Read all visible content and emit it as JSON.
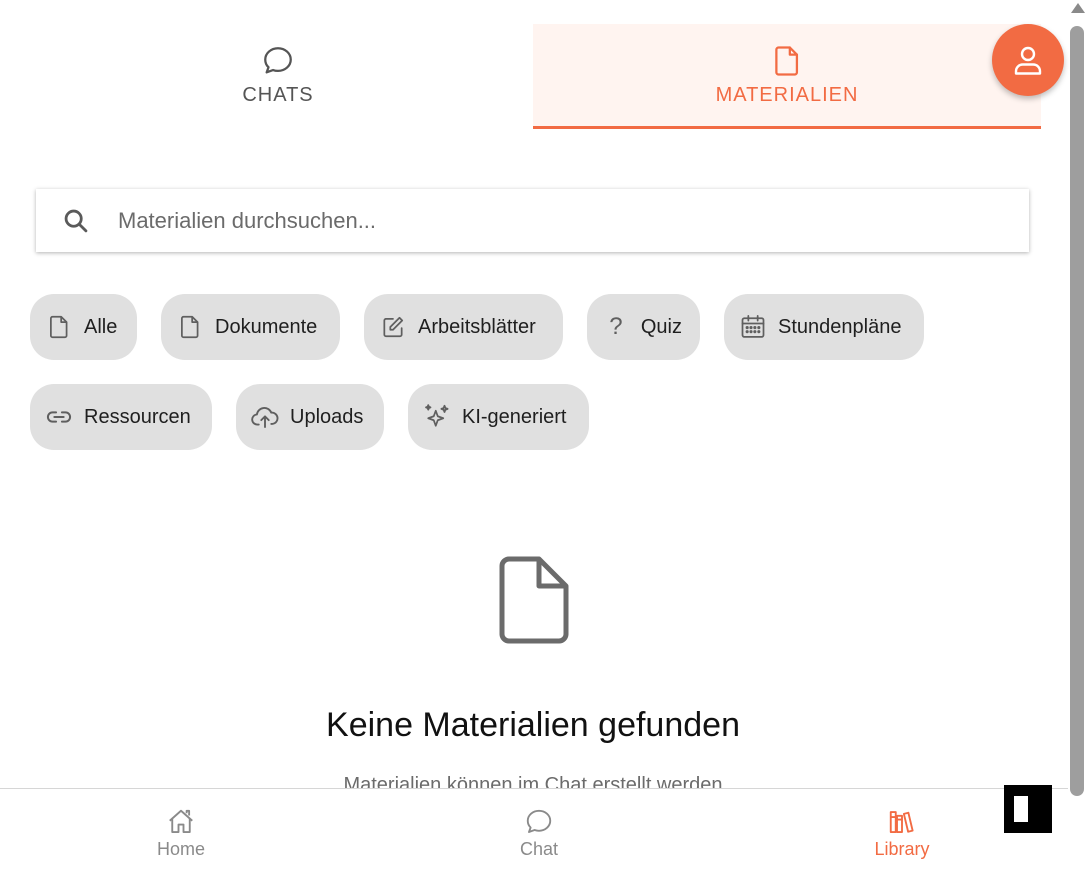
{
  "tabs": {
    "chats_label": "CHATS",
    "materials_label": "MATERIALIEN",
    "active": "materials"
  },
  "search": {
    "placeholder": "Materialien durchsuchen...",
    "value": ""
  },
  "filters": [
    {
      "label": "Alle",
      "icon": "file-icon"
    },
    {
      "label": "Dokumente",
      "icon": "file-icon"
    },
    {
      "label": "Arbeitsblätter",
      "icon": "edit-icon"
    },
    {
      "label": "Quiz",
      "icon": "question-icon"
    },
    {
      "label": "Stundenpläne",
      "icon": "calendar-icon"
    },
    {
      "label": "Ressourcen",
      "icon": "link-icon"
    },
    {
      "label": "Uploads",
      "icon": "cloud-upload-icon"
    },
    {
      "label": "KI-generiert",
      "icon": "sparkles-icon"
    }
  ],
  "empty_state": {
    "title": "Keine Materialien gefunden",
    "subtitle": "Materialien können im Chat erstellt werden"
  },
  "bottom_nav": {
    "home": "Home",
    "chat": "Chat",
    "library": "Library",
    "active": "library"
  },
  "colors": {
    "accent": "#f26b43",
    "accent_bg": "#fff4f0",
    "chip_bg": "#e0e0e0",
    "inactive": "#8a8a8a"
  }
}
